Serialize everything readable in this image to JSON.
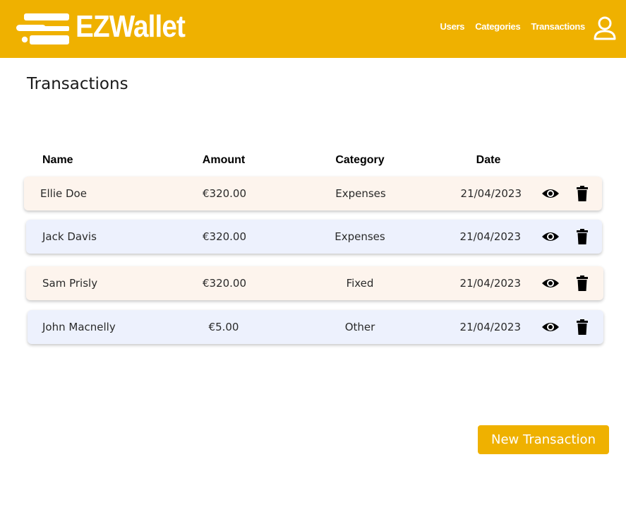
{
  "brand": {
    "name": "EZWallet",
    "logo_icon": "ezwallet-speed-logo",
    "color": "#efb100"
  },
  "nav": {
    "items": [
      {
        "label": "Users"
      },
      {
        "label": "Categories"
      },
      {
        "label": "Transactions"
      }
    ],
    "profile_icon": "user-icon"
  },
  "page": {
    "title": "Transactions"
  },
  "table": {
    "headers": {
      "name": "Name",
      "amount": "Amount",
      "category": "Category",
      "date": "Date"
    },
    "rows": [
      {
        "name": "Ellie Doe",
        "amount": "€320.00",
        "category": "Expenses",
        "date": "21/04/2023",
        "tint": "#fdf4ed"
      },
      {
        "name": "Jack Davis",
        "amount": "€320.00",
        "category": "Expenses",
        "date": "21/04/2023",
        "tint": "#edf1fd"
      },
      {
        "name": "Sam Prisly",
        "amount": "€320.00",
        "category": "Fixed",
        "date": "21/04/2023",
        "tint": "#fdf4ed"
      },
      {
        "name": "John Macnelly",
        "amount": "€5.00",
        "category": "Other",
        "date": "21/04/2023",
        "tint": "#edf1fd"
      }
    ],
    "row_actions": {
      "view_icon": "eye-icon",
      "delete_icon": "trash-icon"
    }
  },
  "actions": {
    "new_transaction_label": "New Transaction"
  }
}
